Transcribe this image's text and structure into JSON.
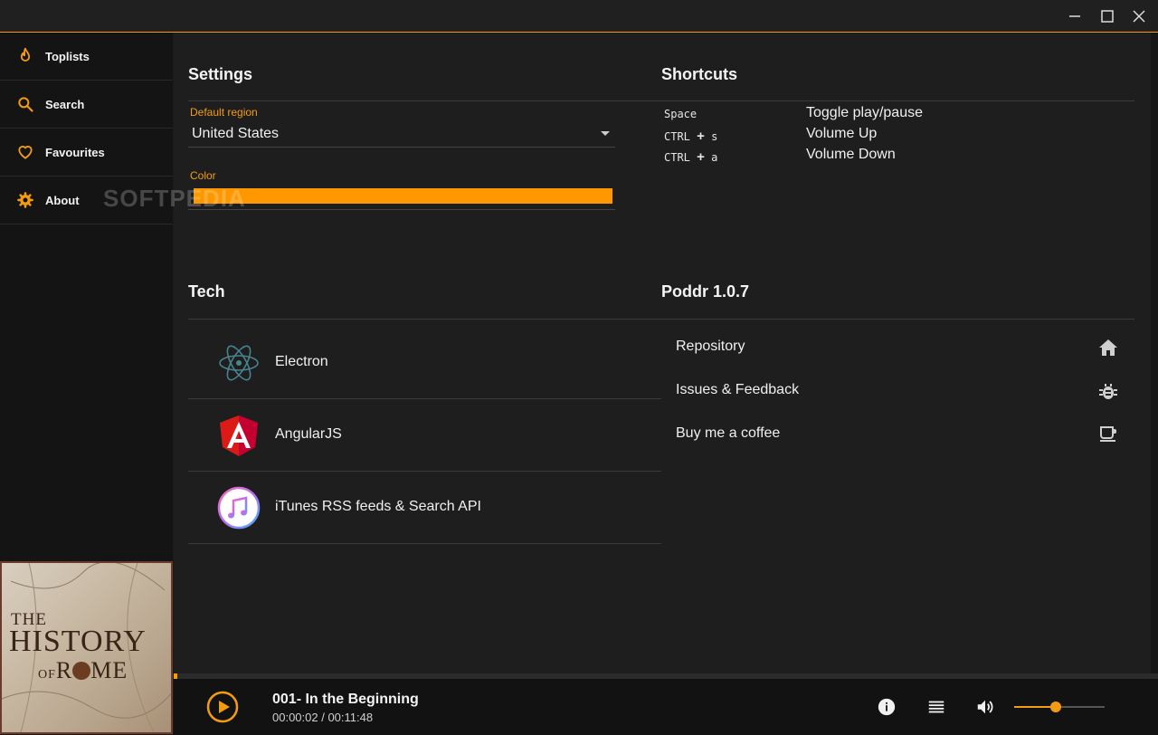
{
  "window": {
    "controls": [
      "minimize",
      "maximize",
      "close"
    ]
  },
  "sidebar": {
    "items": [
      {
        "label": "Toplists",
        "icon": "flame-icon"
      },
      {
        "label": "Search",
        "icon": "search-icon"
      },
      {
        "label": "Favourites",
        "icon": "heart-icon"
      },
      {
        "label": "About",
        "icon": "gear-icon"
      }
    ],
    "album_art": {
      "line1": "THE",
      "line2": "HISTORY",
      "line3_small": "OF",
      "line3": "R",
      "line3b": "ME"
    }
  },
  "settings": {
    "title": "Settings",
    "region_label": "Default region",
    "region_value": "United States",
    "color_label": "Color",
    "color_value": "#ff9800"
  },
  "watermark": "SOFTPEDIA",
  "shortcuts": {
    "title": "Shortcuts",
    "items": [
      {
        "key": "Space",
        "desc": "Toggle play/pause"
      },
      {
        "key": "CTRL + s",
        "desc": "Volume Up"
      },
      {
        "key": "CTRL + a",
        "desc": "Volume Down"
      }
    ]
  },
  "tech": {
    "title": "Tech",
    "items": [
      {
        "name": "Electron",
        "icon": "electron-logo-icon"
      },
      {
        "name": "AngularJS",
        "icon": "angularjs-logo-icon"
      },
      {
        "name": "iTunes RSS feeds & Search API",
        "icon": "itunes-logo-icon"
      }
    ]
  },
  "about": {
    "title": "Poddr 1.0.7",
    "links": [
      {
        "label": "Repository",
        "icon": "home-icon"
      },
      {
        "label": "Issues & Feedback",
        "icon": "bug-icon"
      },
      {
        "label": "Buy me a coffee",
        "icon": "coffee-icon"
      }
    ]
  },
  "player": {
    "episode_title": "001- In the Beginning",
    "time": "00:00:02 / 00:11:48",
    "progress_fraction": 0.003,
    "volume_fraction": 0.46,
    "accent": "#f39c12"
  }
}
